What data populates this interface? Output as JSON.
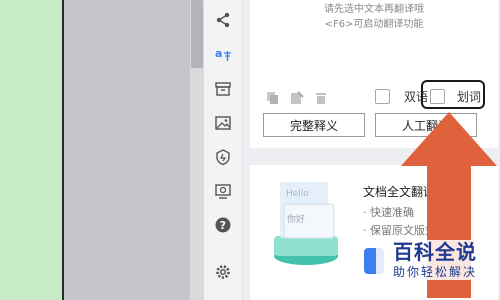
{
  "translation": {
    "hint_line1": "请先选中文本再翻译哦",
    "hint_line2": "<F6>可启动翻译功能",
    "bilingual_label": "双语",
    "word_lookup_label": "划词",
    "full_definition_button": "完整释义",
    "human_translation_button": "人工翻译"
  },
  "toolbar": {
    "icons": [
      "share-icon",
      "translate-icon",
      "archive-icon",
      "image-icon",
      "shield-icon",
      "screen-translate-icon",
      "help-icon",
      "gear-icon"
    ]
  },
  "doc_card": {
    "title": "文档全文翻译",
    "features": [
      "· 快速准确",
      "· 保留原文版式"
    ],
    "illustration_hello": "Hello",
    "illustration_nihao": "你好"
  },
  "watermark": {
    "main": "百科全说",
    "sub": "助你轻松解决"
  },
  "colors": {
    "arrow": "#e0623c",
    "accent": "#3d7ef0",
    "watermark": "#1f3a8f"
  }
}
